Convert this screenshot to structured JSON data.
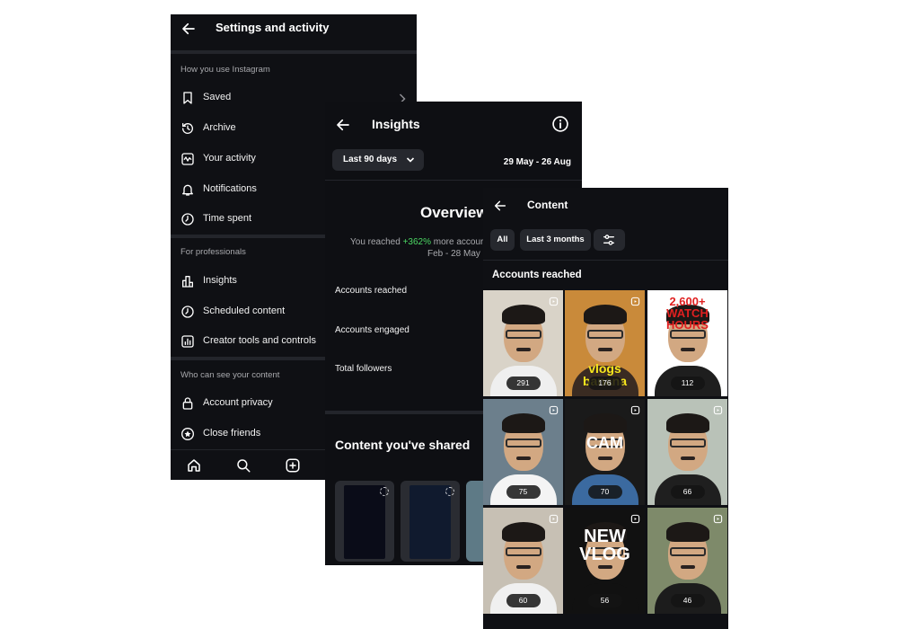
{
  "settings_screen": {
    "title": "Settings and activity",
    "section_usage": "How you use Instagram",
    "items_usage": [
      {
        "label": "Saved",
        "icon": "bookmark-icon"
      },
      {
        "label": "Archive",
        "icon": "archive-icon"
      },
      {
        "label": "Your activity",
        "icon": "activity-icon"
      },
      {
        "label": "Notifications",
        "icon": "bell-icon"
      },
      {
        "label": "Time spent",
        "icon": "clock-icon"
      }
    ],
    "section_pro": "For professionals",
    "items_pro": [
      {
        "label": "Insights",
        "icon": "bar-chart-icon"
      },
      {
        "label": "Scheduled content",
        "icon": "schedule-icon"
      },
      {
        "label": "Creator tools and controls",
        "icon": "creator-tools-icon"
      }
    ],
    "section_visibility": "Who can see your content",
    "items_visibility": [
      {
        "label": "Account privacy",
        "icon": "lock-icon"
      },
      {
        "label": "Close friends",
        "icon": "star-icon"
      }
    ],
    "bottom_nav": [
      "home-icon",
      "search-icon",
      "create-icon"
    ]
  },
  "insights_screen": {
    "title": "Insights",
    "filter_label": "Last 90 days",
    "date_range": "29 May - 26 Aug",
    "overview_title": "Overview",
    "reached_prefix": "You reached",
    "reached_change": "+362%",
    "reached_suffix": "more accour",
    "compare_period": "Feb - 28 May",
    "metrics": [
      "Accounts reached",
      "Accounts engaged",
      "Total followers"
    ],
    "shared_title": "Content you've shared",
    "colors": {
      "accent_green": "#4cd964"
    }
  },
  "content_screen": {
    "title": "Content",
    "chip_all": "All",
    "chip_range": "Last 3 months",
    "subtitle": "Accounts reached",
    "tiles": [
      {
        "count": "291",
        "bg": "#d9d3c8",
        "shirt": "#efefef",
        "text": "",
        "text_color": ""
      },
      {
        "count": "176",
        "bg": "#c98a3a",
        "shirt": "#3a2b22",
        "text": "vlogs banana",
        "text_color": "#f8e71c"
      },
      {
        "count": "112",
        "bg": "#ffffff",
        "shirt": "#1e1e1e",
        "text": "2,600+ WATCH HOURS",
        "text_color": "#e02020"
      },
      {
        "count": "75",
        "bg": "#6c7f8c",
        "shirt": "#f4f4f4",
        "text": "",
        "text_color": ""
      },
      {
        "count": "70",
        "bg": "#1a1a1a",
        "shirt": "#3b6aa0",
        "text": "CAM",
        "text_color": "#ffffff"
      },
      {
        "count": "66",
        "bg": "#b9c2b8",
        "shirt": "#1f1f1f",
        "text": "",
        "text_color": ""
      },
      {
        "count": "60",
        "bg": "#c7c0b4",
        "shirt": "#f0f0f0",
        "text": "",
        "text_color": ""
      },
      {
        "count": "56",
        "bg": "#111111",
        "shirt": "#111111",
        "text": "NEW VLOG",
        "text_color": "#ffffff"
      },
      {
        "count": "46",
        "bg": "#7e8a6a",
        "shirt": "#1c1c1c",
        "text": "",
        "text_color": ""
      }
    ]
  }
}
